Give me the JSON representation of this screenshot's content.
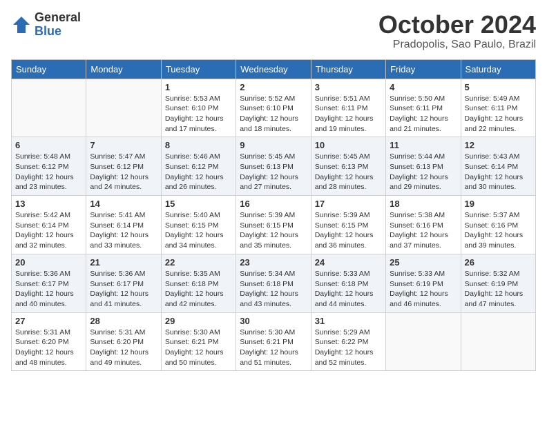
{
  "logo": {
    "general": "General",
    "blue": "Blue"
  },
  "title": "October 2024",
  "location": "Pradopolis, Sao Paulo, Brazil",
  "weekdays": [
    "Sunday",
    "Monday",
    "Tuesday",
    "Wednesday",
    "Thursday",
    "Friday",
    "Saturday"
  ],
  "weeks": [
    [
      {
        "day": "",
        "info": ""
      },
      {
        "day": "",
        "info": ""
      },
      {
        "day": "1",
        "info": "Sunrise: 5:53 AM\nSunset: 6:10 PM\nDaylight: 12 hours and 17 minutes."
      },
      {
        "day": "2",
        "info": "Sunrise: 5:52 AM\nSunset: 6:10 PM\nDaylight: 12 hours and 18 minutes."
      },
      {
        "day": "3",
        "info": "Sunrise: 5:51 AM\nSunset: 6:11 PM\nDaylight: 12 hours and 19 minutes."
      },
      {
        "day": "4",
        "info": "Sunrise: 5:50 AM\nSunset: 6:11 PM\nDaylight: 12 hours and 21 minutes."
      },
      {
        "day": "5",
        "info": "Sunrise: 5:49 AM\nSunset: 6:11 PM\nDaylight: 12 hours and 22 minutes."
      }
    ],
    [
      {
        "day": "6",
        "info": "Sunrise: 5:48 AM\nSunset: 6:12 PM\nDaylight: 12 hours and 23 minutes."
      },
      {
        "day": "7",
        "info": "Sunrise: 5:47 AM\nSunset: 6:12 PM\nDaylight: 12 hours and 24 minutes."
      },
      {
        "day": "8",
        "info": "Sunrise: 5:46 AM\nSunset: 6:12 PM\nDaylight: 12 hours and 26 minutes."
      },
      {
        "day": "9",
        "info": "Sunrise: 5:45 AM\nSunset: 6:13 PM\nDaylight: 12 hours and 27 minutes."
      },
      {
        "day": "10",
        "info": "Sunrise: 5:45 AM\nSunset: 6:13 PM\nDaylight: 12 hours and 28 minutes."
      },
      {
        "day": "11",
        "info": "Sunrise: 5:44 AM\nSunset: 6:13 PM\nDaylight: 12 hours and 29 minutes."
      },
      {
        "day": "12",
        "info": "Sunrise: 5:43 AM\nSunset: 6:14 PM\nDaylight: 12 hours and 30 minutes."
      }
    ],
    [
      {
        "day": "13",
        "info": "Sunrise: 5:42 AM\nSunset: 6:14 PM\nDaylight: 12 hours and 32 minutes."
      },
      {
        "day": "14",
        "info": "Sunrise: 5:41 AM\nSunset: 6:14 PM\nDaylight: 12 hours and 33 minutes."
      },
      {
        "day": "15",
        "info": "Sunrise: 5:40 AM\nSunset: 6:15 PM\nDaylight: 12 hours and 34 minutes."
      },
      {
        "day": "16",
        "info": "Sunrise: 5:39 AM\nSunset: 6:15 PM\nDaylight: 12 hours and 35 minutes."
      },
      {
        "day": "17",
        "info": "Sunrise: 5:39 AM\nSunset: 6:15 PM\nDaylight: 12 hours and 36 minutes."
      },
      {
        "day": "18",
        "info": "Sunrise: 5:38 AM\nSunset: 6:16 PM\nDaylight: 12 hours and 37 minutes."
      },
      {
        "day": "19",
        "info": "Sunrise: 5:37 AM\nSunset: 6:16 PM\nDaylight: 12 hours and 39 minutes."
      }
    ],
    [
      {
        "day": "20",
        "info": "Sunrise: 5:36 AM\nSunset: 6:17 PM\nDaylight: 12 hours and 40 minutes."
      },
      {
        "day": "21",
        "info": "Sunrise: 5:36 AM\nSunset: 6:17 PM\nDaylight: 12 hours and 41 minutes."
      },
      {
        "day": "22",
        "info": "Sunrise: 5:35 AM\nSunset: 6:18 PM\nDaylight: 12 hours and 42 minutes."
      },
      {
        "day": "23",
        "info": "Sunrise: 5:34 AM\nSunset: 6:18 PM\nDaylight: 12 hours and 43 minutes."
      },
      {
        "day": "24",
        "info": "Sunrise: 5:33 AM\nSunset: 6:18 PM\nDaylight: 12 hours and 44 minutes."
      },
      {
        "day": "25",
        "info": "Sunrise: 5:33 AM\nSunset: 6:19 PM\nDaylight: 12 hours and 46 minutes."
      },
      {
        "day": "26",
        "info": "Sunrise: 5:32 AM\nSunset: 6:19 PM\nDaylight: 12 hours and 47 minutes."
      }
    ],
    [
      {
        "day": "27",
        "info": "Sunrise: 5:31 AM\nSunset: 6:20 PM\nDaylight: 12 hours and 48 minutes."
      },
      {
        "day": "28",
        "info": "Sunrise: 5:31 AM\nSunset: 6:20 PM\nDaylight: 12 hours and 49 minutes."
      },
      {
        "day": "29",
        "info": "Sunrise: 5:30 AM\nSunset: 6:21 PM\nDaylight: 12 hours and 50 minutes."
      },
      {
        "day": "30",
        "info": "Sunrise: 5:30 AM\nSunset: 6:21 PM\nDaylight: 12 hours and 51 minutes."
      },
      {
        "day": "31",
        "info": "Sunrise: 5:29 AM\nSunset: 6:22 PM\nDaylight: 12 hours and 52 minutes."
      },
      {
        "day": "",
        "info": ""
      },
      {
        "day": "",
        "info": ""
      }
    ]
  ]
}
